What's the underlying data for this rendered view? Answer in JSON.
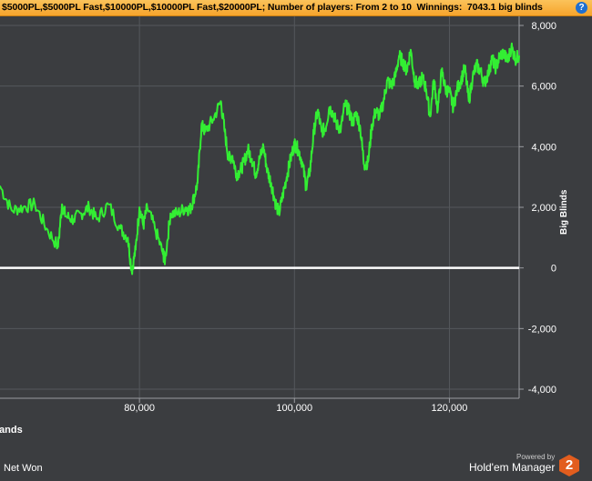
{
  "header": {
    "title": "$5000PL,$5000PL Fast,$10000PL,$10000PL Fast,$20000PL; Number of players: From 2 to 10",
    "winnings_label": "Winnings:",
    "winnings_value": "7043.1 big blinds",
    "help_glyph": "?"
  },
  "colors": {
    "line": "#33ee33",
    "zero_line": "#ffffff",
    "header": "#f6a42c",
    "background": "#3b3d40"
  },
  "chart_data": {
    "type": "line",
    "title": "",
    "xlabel": "Hands",
    "xlabel_visible": "lands",
    "ylabel": "Big Blinds",
    "xlim": [
      62000,
      129000
    ],
    "ylim": [
      -4300,
      8300
    ],
    "x_ticks": [
      80000,
      100000,
      120000
    ],
    "x_tick_labels": [
      "80,000",
      "100,000",
      "120,000"
    ],
    "y_ticks": [
      8000,
      6000,
      4000,
      2000,
      0,
      -2000,
      -4000
    ],
    "y_tick_labels": [
      "8,000",
      "6,000",
      "4,000",
      "2,000",
      "0",
      "-2,000",
      "-4,000"
    ],
    "grid": true,
    "series": [
      {
        "name": "Net Won",
        "x": [
          62000,
          63500,
          65000,
          66500,
          68000,
          69500,
          70000,
          70500,
          71500,
          72500,
          73500,
          74500,
          76000,
          77500,
          78500,
          79000,
          79500,
          80000,
          80500,
          81000,
          82000,
          83000,
          83300,
          84000,
          85000,
          86000,
          86500,
          87000,
          87500,
          88000,
          88500,
          89500,
          90500,
          91000,
          91500,
          92000,
          92500,
          93000,
          93500,
          94000,
          94500,
          95000,
          95500,
          96000,
          96500,
          97000,
          97500,
          98000,
          98500,
          99000,
          99500,
          100000,
          100500,
          101000,
          101500,
          102000,
          102500,
          103000,
          103500,
          104000,
          104500,
          105000,
          105500,
          106000,
          106500,
          107000,
          107500,
          108000,
          108500,
          109000,
          109500,
          110000,
          110500,
          111000,
          111500,
          112000,
          112500,
          113000,
          113500,
          114000,
          114500,
          115000,
          115500,
          116000,
          116500,
          117000,
          117500,
          118000,
          118500,
          119000,
          119500,
          120000,
          120500,
          121000,
          121500,
          122000,
          122500,
          123000,
          123500,
          124000,
          124500,
          125000,
          125500,
          126000,
          126500,
          127000,
          127500,
          128000,
          128500,
          129000
        ],
        "y": [
          2700,
          1900,
          2000,
          2100,
          1300,
          700,
          2100,
          1700,
          1600,
          1800,
          2000,
          1600,
          2100,
          1300,
          1000,
          -100,
          600,
          2000,
          1400,
          2000,
          1300,
          500,
          250,
          1800,
          1800,
          2000,
          1900,
          2300,
          2800,
          4700,
          4500,
          4900,
          5500,
          4500,
          3600,
          3700,
          3100,
          3200,
          3500,
          3900,
          3600,
          3100,
          3600,
          4000,
          3200,
          2800,
          2200,
          1800,
          2400,
          3000,
          3600,
          4100,
          3900,
          3500,
          2700,
          3200,
          4500,
          5200,
          4500,
          4600,
          5300,
          5100,
          4700,
          4600,
          5400,
          5200,
          4800,
          5100,
          4600,
          3400,
          3500,
          4700,
          5200,
          5000,
          5500,
          6200,
          6000,
          6300,
          7000,
          6800,
          6500,
          7200,
          6200,
          6000,
          6300,
          5900,
          5000,
          6200,
          5200,
          6500,
          5900,
          5800,
          5300,
          5900,
          6200,
          6600,
          5500,
          6300,
          6700,
          6500,
          6100,
          6400,
          6900,
          6600,
          7000,
          7100,
          6800,
          7300,
          6900,
          7000
        ]
      }
    ]
  },
  "legend": {
    "label": "Net Won"
  },
  "branding": {
    "powered_by": "Powered by",
    "product": "Hold'em Manager",
    "logo_text": "2"
  }
}
